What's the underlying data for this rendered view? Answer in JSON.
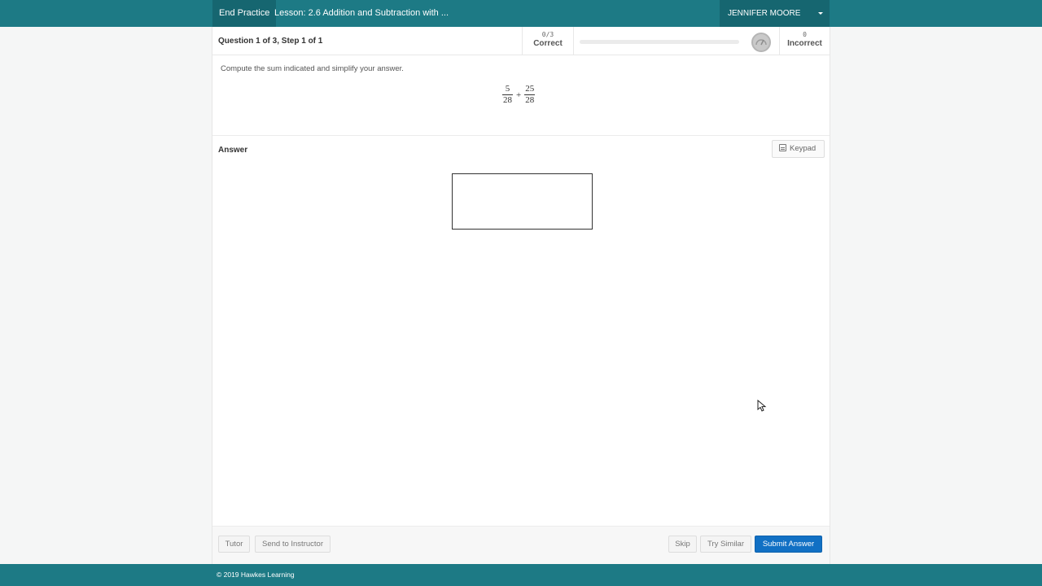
{
  "header": {
    "end_practice": "End Practice",
    "lesson_title": "Lesson: 2.6 Addition and Subtraction with ...",
    "user_name": "JENNIFER MOORE"
  },
  "status": {
    "question_info": "Question 1 of 3,  Step 1 of 1",
    "correct_count": "0/3",
    "correct_label": "Correct",
    "incorrect_count": "0",
    "incorrect_label": "Incorrect",
    "progress_fraction": 0
  },
  "question": {
    "prompt": "Compute the sum indicated and simplify your answer.",
    "fraction1": {
      "numerator": "5",
      "denominator": "28"
    },
    "operator": "+",
    "fraction2": {
      "numerator": "25",
      "denominator": "28"
    }
  },
  "answer": {
    "label": "Answer",
    "keypad_label": "Keypad",
    "input_value": ""
  },
  "actions": {
    "tutor": "Tutor",
    "send_to_instructor": "Send to Instructor",
    "skip": "Skip",
    "try_similar": "Try Similar",
    "submit": "Submit Answer"
  },
  "footer": {
    "copyright": "© 2019 Hawkes Learning"
  },
  "colors": {
    "header_bg": "#1d7a85",
    "submit_bg": "#1170c4"
  }
}
